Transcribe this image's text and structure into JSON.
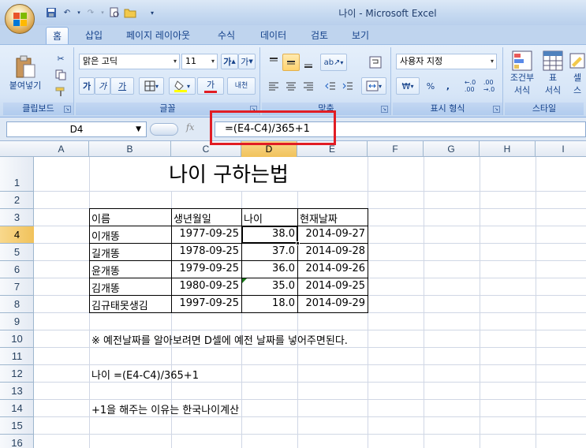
{
  "window": {
    "title": "나이 - Microsoft Excel"
  },
  "tabs": [
    "홈",
    "삽입",
    "페이지 레이아웃",
    "수식",
    "데이터",
    "검토",
    "보기"
  ],
  "ribbon": {
    "clipboard": {
      "paste": "붙여넣기",
      "label": "클립보드"
    },
    "font": {
      "name": "맑은 고딕",
      "size": "11",
      "bold": "가",
      "italic": "가",
      "underline": "가",
      "font_color": "가",
      "phonetic": "내천",
      "label": "글꼴"
    },
    "alignment": {
      "label": "맞춤"
    },
    "number": {
      "format": "사용자 지정",
      "currency": "₩",
      "percent": "%",
      "comma": ",",
      "label": "표시 형식"
    },
    "styles": {
      "conditional": "조건부",
      "conditional2": "서식",
      "table": "표",
      "table2": "서식",
      "cell": "셀",
      "cell2": "스",
      "label": "스타일"
    }
  },
  "formula_bar": {
    "name_box": "D4",
    "fx": "fx",
    "formula": "=(E4-C4)/365+1"
  },
  "columns": [
    "A",
    "B",
    "C",
    "D",
    "E",
    "F",
    "G",
    "H",
    "I"
  ],
  "rows": [
    "1",
    "2",
    "3",
    "4",
    "5",
    "6",
    "7",
    "8",
    "9",
    "10",
    "11",
    "12",
    "13",
    "14",
    "15",
    "16"
  ],
  "selected": {
    "column": "D",
    "row": "4"
  },
  "sheet": {
    "title": "나이 구하는법",
    "headers": [
      "이름",
      "생년월일",
      "나이",
      "현재날짜"
    ],
    "records": [
      [
        "이개똥",
        "1977-09-25",
        "38.0",
        "2014-09-27"
      ],
      [
        "길개똥",
        "1978-09-25",
        "37.0",
        "2014-09-28"
      ],
      [
        "윤개똥",
        "1979-09-25",
        "36.0",
        "2014-09-26"
      ],
      [
        "김개똥",
        "1980-09-25",
        "35.0",
        "2014-09-25"
      ],
      [
        "김규태못생김",
        "1997-09-25",
        "18.0",
        "2014-09-29"
      ]
    ],
    "note1": "※ 예전날짜를 알아보려면 D셀에 예전 날짜를 넣어주면된다.",
    "note2": "나이 =(E4-C4)/365+1",
    "note3": "+1을 해주는 이유는 한국나이계산"
  }
}
